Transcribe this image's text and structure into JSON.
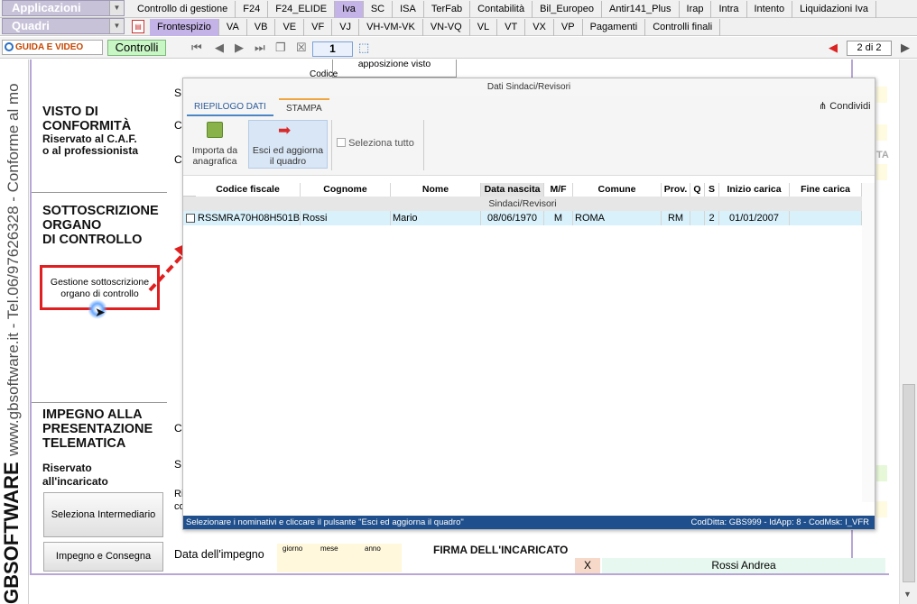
{
  "menu": {
    "applicazioni_label": "Applicazioni",
    "quadri_label": "Quadri",
    "row1_tabs": [
      "Controllo di gestione",
      "F24",
      "F24_ELIDE",
      "Iva",
      "SC",
      "ISA",
      "TerFab",
      "Contabilità",
      "Bil_Europeo",
      "Antir141_Plus",
      "Irap",
      "Intra",
      "Intento",
      "Liquidazioni Iva"
    ],
    "row1_active": "Iva",
    "row2_tabs": [
      "Frontespizio",
      "VA",
      "VB",
      "VE",
      "VF",
      "VJ",
      "VH-VM-VK",
      "VN-VQ",
      "VL",
      "VT",
      "VX",
      "VP",
      "Pagamenti",
      "Controlli finali"
    ],
    "row2_active": "Frontespizio"
  },
  "toolbar": {
    "guida_label": "GUIDA E VIDEO",
    "controlli_label": "Controlli",
    "page_number": "1",
    "page_count": "2 di 2"
  },
  "left_strip": {
    "website_text": "www.gbsoftware.it - Tel.06/97626328 - Conforme al mo",
    "brand_text": "GBSOFTWARE"
  },
  "form": {
    "codice_fragment": "Codice",
    "apposizione_text": "apposizione visto",
    "visto_title": "VISTO DI\nCONFORMITÀ",
    "visto_sub": "Riservato al C.A.F.\no al professionista",
    "sottoscrizione_title": "SOTTOSCRIZIONE\nORGANO\nDI CONTROLLO",
    "gestione_button": "Gestione sottoscrizione\norgano di controllo",
    "impegno_title": "IMPEGNO ALLA\nPRESENTAZIONE\nTELEMATICA",
    "impegno_sub": "Riservato\nall'incaricato",
    "seleziona_button": "Seleziona Intermediario",
    "impegno_button": "Impegno e Consegna",
    "data_impegno_label": "Data dell'impegno",
    "giorno_label": "giorno",
    "mese_label": "mese",
    "anno_label": "anno",
    "firma_label": "FIRMA DELL'INCARICATO",
    "x_mark": "X",
    "incaricato_name": "Rossi Andrea",
    "frag_s": "S",
    "frag_c": "C",
    "frag_ri": "Ri",
    "frag_co": "co",
    "frag_ta": "TA"
  },
  "modal": {
    "title": "Dati Sindaci/Revisori",
    "tab_riepilogo": "RIEPILOGO DATI",
    "tab_stampa": "STAMPA",
    "condividi_label": "Condividi",
    "importa_label": "Importa da\nanagrafica",
    "esci_label": "Esci ed aggiorna\nil quadro",
    "seleziona_tutto_label": "Seleziona tutto",
    "columns": [
      "Codice fiscale",
      "Cognome",
      "Nome",
      "Data nascita",
      "M/F",
      "Comune",
      "Prov.",
      "Q",
      "S",
      "Inizio carica",
      "Fine carica"
    ],
    "group_label": "Sindaci/Revisori",
    "rows": [
      [
        "RSSMRA70H08H501B",
        "Rossi",
        "Mario",
        "08/06/1970",
        "M",
        "ROMA",
        "RM",
        "",
        "2",
        "01/01/2007",
        ""
      ]
    ],
    "status_left": "Selezionare i nominativi e cliccare il pulsante \"Esci ed aggiorna il quadro\"",
    "status_right": "CodDitta: GBS999 - IdApp: 8 - CodMsk: I_VFR"
  },
  "colors": {
    "accent_purple": "#c4b3e6",
    "status_bar_blue": "#1f4f8c",
    "highlight_red": "#e02020",
    "selected_row": "#d9f1fb"
  }
}
